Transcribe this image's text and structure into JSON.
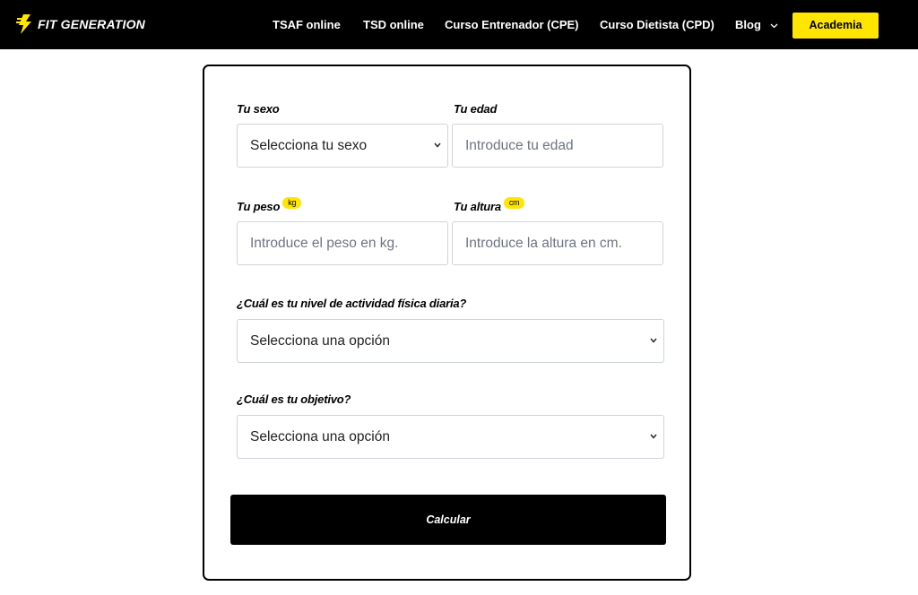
{
  "header": {
    "brand": "FIT GENERATION",
    "nav": [
      "TSAF online",
      "TSD online",
      "Curso Entrenador (CPE)",
      "Curso Dietista (CPD)",
      "Blog"
    ],
    "cta": "Academia"
  },
  "form": {
    "sex": {
      "label": "Tu sexo",
      "value": "Selecciona tu sexo"
    },
    "age": {
      "label": "Tu edad",
      "placeholder": "Introduce tu edad"
    },
    "weight": {
      "label": "Tu peso",
      "unit": "kg",
      "placeholder": "Introduce el peso en kg."
    },
    "height": {
      "label": "Tu altura",
      "unit": "cm",
      "placeholder": "Introduce la altura en cm."
    },
    "activity": {
      "label": "¿Cuál es tu nivel de actividad física diaria?",
      "value": "Selecciona una opción"
    },
    "goal": {
      "label": "¿Cuál es tu objetivo?",
      "value": "Selecciona una opción"
    },
    "submit": "Calcular"
  },
  "colors": {
    "accent": "#ffe600",
    "dark": "#000000",
    "border": "#cfd4d9"
  }
}
